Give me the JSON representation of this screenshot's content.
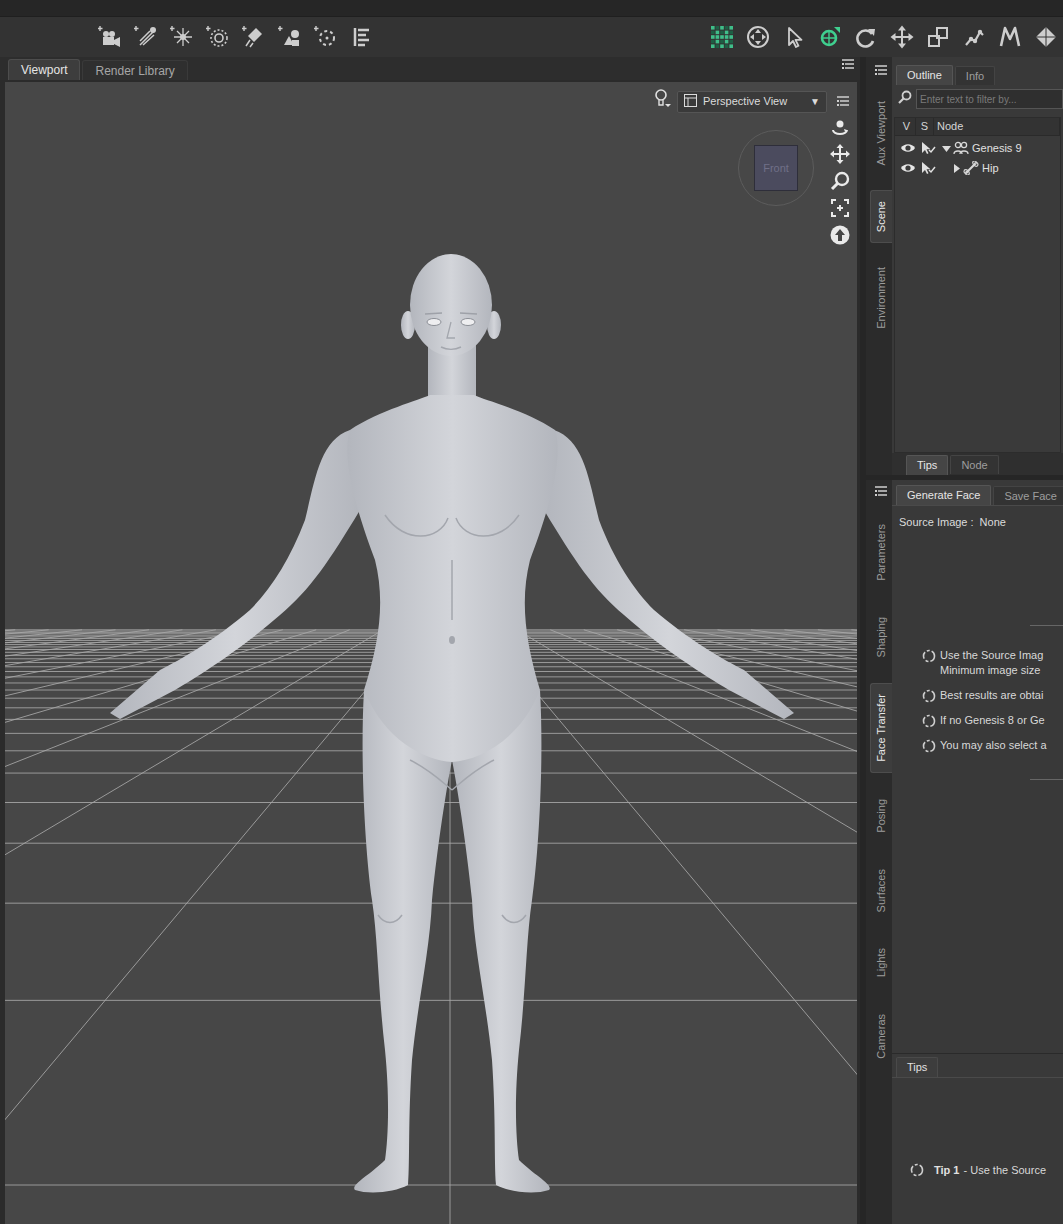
{
  "main_tabs": [
    {
      "label": "Viewport",
      "selected": true
    },
    {
      "label": "Render Library",
      "selected": false
    }
  ],
  "tools": [
    {
      "selected": false
    },
    {
      "selected": false
    },
    {
      "selected": true
    },
    {
      "selected": false
    },
    {
      "selected": false
    },
    {
      "selected": false
    },
    {
      "selected": false
    },
    {
      "selected": false
    },
    {
      "selected": false
    }
  ],
  "viewport": {
    "camera": "Perspective View",
    "camera_arrow": "▼",
    "nav_cube_face": "Front"
  },
  "upper_side_tabs": [
    {
      "label": "Aux Viewport",
      "selected": false
    },
    {
      "label": "Scene",
      "selected": true
    },
    {
      "label": "Environment",
      "selected": false
    }
  ],
  "scene": {
    "tabs": [
      {
        "label": "Outline",
        "selected": true
      },
      {
        "label": "Info",
        "selected": false
      }
    ],
    "filter": {
      "placeholder": "Enter text to filter by..."
    },
    "columns": [
      "V",
      "S",
      "Node"
    ],
    "nodes": [
      {
        "label": "Genesis 9",
        "depth": 0,
        "expanded": true,
        "kind": "figure"
      },
      {
        "label": "Hip",
        "depth": 1,
        "expanded": false,
        "kind": "bone"
      }
    ],
    "bottom_tabs": [
      {
        "label": "Tips",
        "selected": true
      },
      {
        "label": "Node",
        "selected": false
      }
    ]
  },
  "lower_side_tabs": [
    {
      "label": "Parameters",
      "selected": false
    },
    {
      "label": "Shaping",
      "selected": false
    },
    {
      "label": "Face Transfer",
      "selected": true
    },
    {
      "label": "Posing",
      "selected": false
    },
    {
      "label": "Surfaces",
      "selected": false
    },
    {
      "label": "Lights",
      "selected": false
    },
    {
      "label": "Cameras",
      "selected": false
    }
  ],
  "face_transfer": {
    "tabs": [
      {
        "label": "Generate Face",
        "selected": true
      },
      {
        "label": "Save Face",
        "selected": false
      }
    ],
    "source_label": "Source Image :",
    "source_value": "None",
    "notes": [
      {
        "lines": [
          "Use the Source Imag",
          "Minimum image size"
        ]
      },
      {
        "lines": [
          "Best results are obtai"
        ]
      },
      {
        "lines": [
          "If no Genesis 8 or Ge"
        ]
      },
      {
        "lines": [
          "You may also select a"
        ]
      }
    ],
    "tips_tab": "Tips",
    "tip": {
      "title": "Tip 1",
      "text": "- Use the Source"
    }
  }
}
